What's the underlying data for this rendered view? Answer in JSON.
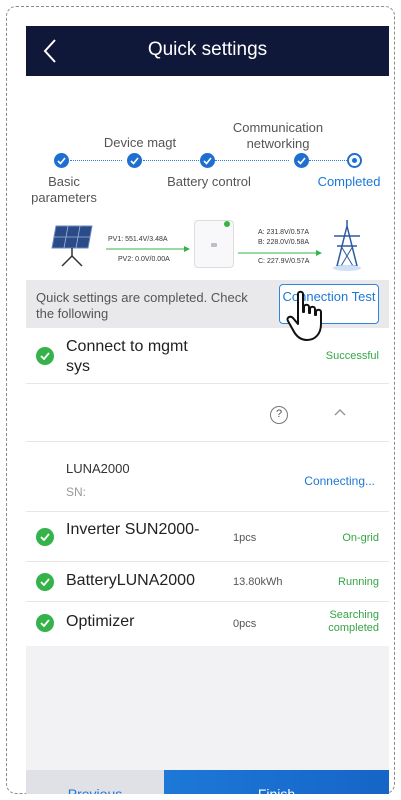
{
  "header": {
    "title": "Quick settings"
  },
  "stepper": {
    "steps": [
      {
        "label": "Basic\nparameters",
        "state": "done"
      },
      {
        "label": "Device magt",
        "state": "done"
      },
      {
        "label": "Battery control",
        "state": "done"
      },
      {
        "label": "Communication\nnetworking",
        "state": "done"
      },
      {
        "label": "Completed",
        "state": "current"
      }
    ]
  },
  "flow": {
    "pv1": "PV1: 551.4V/3.48A",
    "pv2": "PV2: 0.0V/0.00A",
    "phase_a": "A: 231.8V/0.57A",
    "phase_b": "B: 228.0V/0.58A",
    "phase_c": "C: 227.9V/0.57A"
  },
  "info": {
    "text": "Quick settings are completed. Check the following",
    "button": "Connection Test"
  },
  "rows": {
    "mgmt": {
      "title": "Connect to mgmt sys",
      "status": "Successful"
    },
    "luna_device": {
      "title": "LUNA2000",
      "sn": "SN:",
      "status": "Connecting..."
    },
    "inverter": {
      "title": "Inverter SUN2000-",
      "qty": "1pcs",
      "status": "On-grid"
    },
    "battery": {
      "title": "BatteryLUNA2000",
      "qty": "13.80kWh",
      "status": "Running"
    },
    "optimizer": {
      "title": "Optimizer",
      "qty": "0pcs",
      "status": "Searching completed"
    }
  },
  "buttons": {
    "previous": "Previous",
    "finish": "Finish"
  },
  "colors": {
    "header": "#10183a",
    "accent": "#1d78d5",
    "success": "#35b34a"
  }
}
